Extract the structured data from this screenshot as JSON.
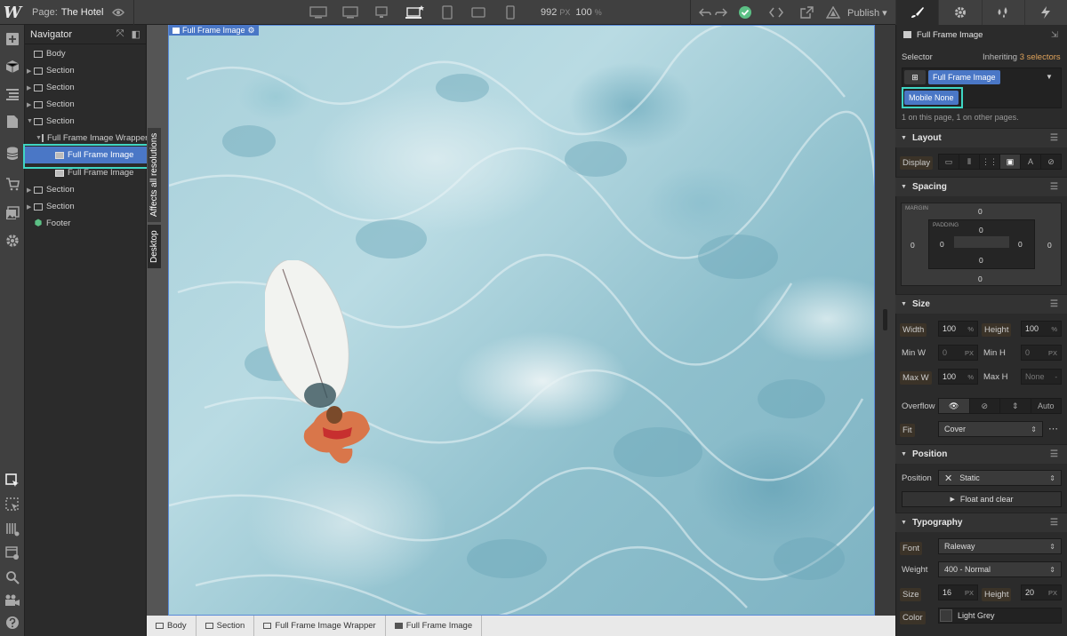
{
  "topbar": {
    "logo": "W",
    "page_label": "Page:",
    "page_name": "The Hotel",
    "width_value": "992",
    "width_unit": "PX",
    "zoom_value": "100",
    "zoom_unit": "%",
    "publish_label": "Publish"
  },
  "navigator": {
    "title": "Navigator",
    "items": [
      {
        "label": "Body"
      },
      {
        "label": "Section"
      },
      {
        "label": "Section"
      },
      {
        "label": "Section"
      },
      {
        "label": "Section"
      },
      {
        "label": "Full Frame Image Wrapper"
      },
      {
        "label": "Full Frame Image"
      },
      {
        "label": "Full Frame Image"
      },
      {
        "label": "Section"
      },
      {
        "label": "Section"
      },
      {
        "label": "Footer"
      }
    ]
  },
  "vertical_tabs": {
    "affects": "Affects all resolutions",
    "desktop": "Desktop"
  },
  "canvas": {
    "selected_label": "Full Frame Image"
  },
  "breadcrumb": [
    "Body",
    "Section",
    "Full Frame Image Wrapper",
    "Full Frame Image"
  ],
  "panel": {
    "element_name": "Full Frame Image",
    "selector_label": "Selector",
    "inheriting_prefix": "Inheriting",
    "inheriting_link": "3 selectors",
    "class_pill": "Full Frame Image",
    "combo_pill": "Mobile None",
    "usage_note": "1 on this page, 1 on other pages.",
    "layout": {
      "title": "Layout",
      "display_label": "Display"
    },
    "spacing": {
      "title": "Spacing",
      "margin_label": "MARGIN",
      "padding_label": "PADDING",
      "margin_top": "0",
      "margin_bottom": "0",
      "margin_left": "0",
      "margin_right": "0",
      "padding_top": "0",
      "padding_bottom": "0",
      "padding_left": "0",
      "padding_right": "0"
    },
    "size": {
      "title": "Size",
      "width_label": "Width",
      "width_value": "100",
      "width_unit": "%",
      "height_label": "Height",
      "height_value": "100",
      "height_unit": "%",
      "minw_label": "Min W",
      "minw_value": "0",
      "minw_unit": "PX",
      "minh_label": "Min H",
      "minh_value": "0",
      "minh_unit": "PX",
      "maxw_label": "Max W",
      "maxw_value": "100",
      "maxw_unit": "%",
      "maxh_label": "Max H",
      "maxh_value": "None",
      "maxh_unit": "-",
      "overflow_label": "Overflow",
      "overflow_auto": "Auto",
      "fit_label": "Fit",
      "fit_value": "Cover"
    },
    "position": {
      "title": "Position",
      "position_label": "Position",
      "position_value": "Static",
      "float_label": "Float and clear"
    },
    "typography": {
      "title": "Typography",
      "font_label": "Font",
      "font_value": "Raleway",
      "weight_label": "Weight",
      "weight_value": "400 - Normal",
      "size_label": "Size",
      "size_value": "16",
      "size_unit": "PX",
      "lh_label": "Height",
      "lh_value": "20",
      "lh_unit": "PX",
      "color_label": "Color",
      "color_value": "Light Grey"
    }
  },
  "colors": {
    "accent": "#4a77c6",
    "highlight": "#3fd6c4",
    "orange_label": "#e0a35a"
  }
}
